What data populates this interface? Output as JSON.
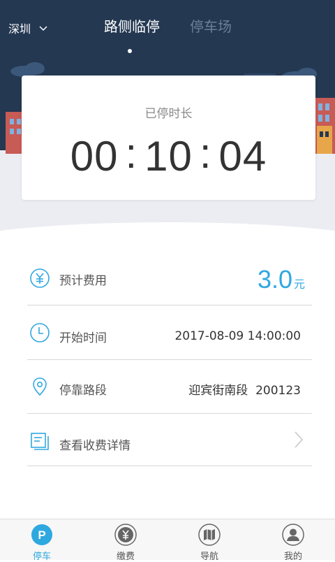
{
  "header": {
    "city": "深圳",
    "tabs": [
      {
        "label": "路侧临停",
        "active": true
      },
      {
        "label": "停车场",
        "active": false
      }
    ]
  },
  "timer": {
    "label": "已停时长",
    "hours": "00",
    "minutes": "10",
    "seconds": "04",
    "separator": ":"
  },
  "details": {
    "fee": {
      "label": "预计费用",
      "amount": "3.0",
      "unit": "元"
    },
    "start_time": {
      "label": "开始时间",
      "value": "2017-08-09 14:00:00"
    },
    "road": {
      "label": "停靠路段",
      "name": "迎宾街南段",
      "code": "200123"
    },
    "details_link": {
      "label": "查看收费详情"
    }
  },
  "bottom_nav": [
    {
      "label": "停车",
      "icon": "parking-icon",
      "active": true
    },
    {
      "label": "缴费",
      "icon": "yuan-coin-icon",
      "active": false
    },
    {
      "label": "导航",
      "icon": "map-icon",
      "active": false
    },
    {
      "label": "我的",
      "icon": "user-icon",
      "active": false
    }
  ],
  "colors": {
    "header_bg": "#243852",
    "accent": "#2fa8e0",
    "page_bg": "#ecedf2"
  }
}
